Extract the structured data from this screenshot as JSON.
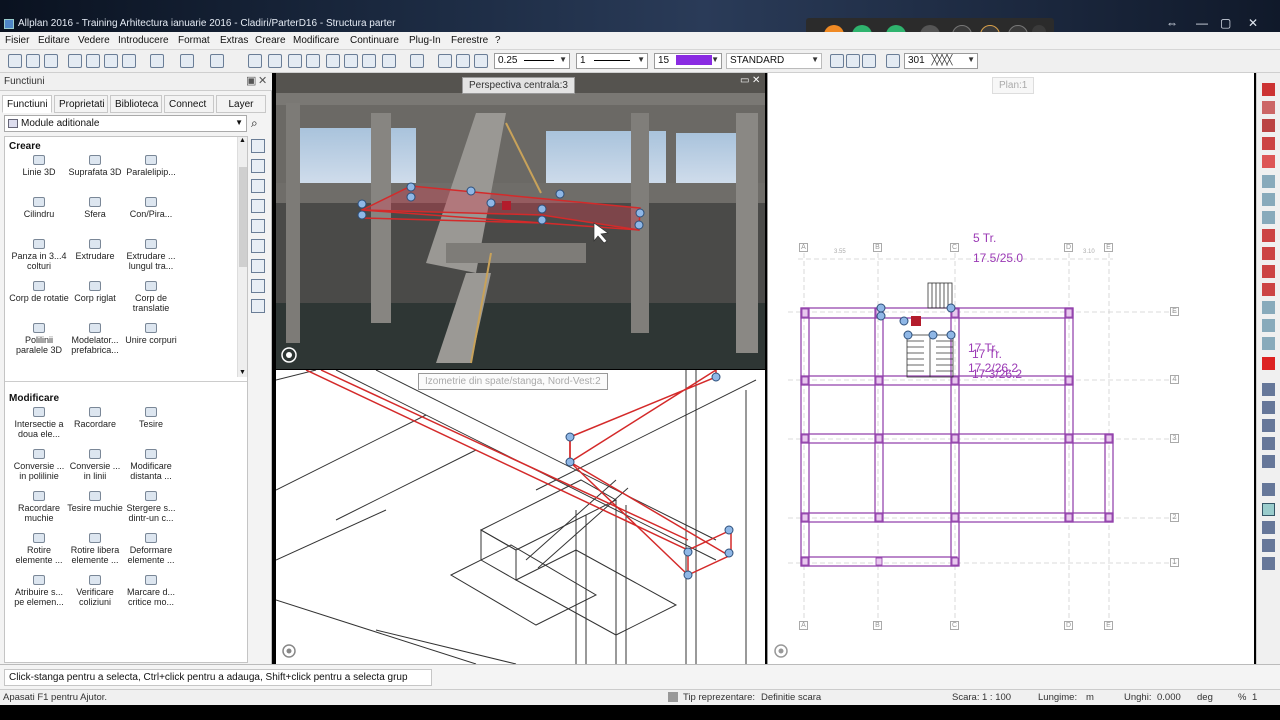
{
  "window": {
    "title": "Allplan 2016 - Training Arhitectura ianuarie 2016 - Cladiri/ParterD16 - Structura parter"
  },
  "menu": [
    "Fisier",
    "Editare",
    "Vedere",
    "Introducere",
    "Format",
    "Extras",
    "Creare",
    "Modificare",
    "Continuare",
    "Plug-In",
    "Ferestre",
    "?"
  ],
  "toolbar": {
    "pen_thickness": "0.25",
    "line_type": "1",
    "color_number": "15",
    "color_swatch": "#8a2be2",
    "layer": "STANDARD",
    "hatch_number": "301"
  },
  "panel": {
    "title": "Functiuni",
    "tabs": [
      "Functiuni",
      "Proprietati",
      "Biblioteca",
      "Connect",
      "Layer"
    ],
    "module": "Module aditionale",
    "section_create": "Creare",
    "create_tools": [
      {
        "icon": "line-3d-icon",
        "label": "Linie 3D"
      },
      {
        "icon": "surface-3d-icon",
        "label": "Suprafata 3D"
      },
      {
        "icon": "box-icon",
        "label": "Paralelipip..."
      },
      {
        "icon": "cylinder-icon",
        "label": "Cilindru"
      },
      {
        "icon": "sphere-icon",
        "label": "Sfera"
      },
      {
        "icon": "cone-icon",
        "label": "Con/Pira..."
      },
      {
        "icon": "panel-icon",
        "label": "Panza in 3...4 colturi"
      },
      {
        "icon": "extrusion-icon",
        "label": "Extrudare"
      },
      {
        "icon": "path-extrusion-icon",
        "label": "Extrudare ... lungul tra..."
      },
      {
        "icon": "rotation-body-icon",
        "label": "Corp de rotatie"
      },
      {
        "icon": "ruled-body-icon",
        "label": "Corp riglat"
      },
      {
        "icon": "translation-body-icon",
        "label": "Corp de translatie"
      },
      {
        "icon": "polyline-icon",
        "label": "Polilinii paralele 3D"
      },
      {
        "icon": "prefab-modeler-icon",
        "label": "Modelator... prefabrica..."
      },
      {
        "icon": "union-icon",
        "label": "Unire corpuri"
      }
    ],
    "section_modify": "Modificare",
    "modify_tools": [
      {
        "icon": "intersect-icon",
        "label": "Intersectie a doua ele..."
      },
      {
        "icon": "fillet-icon",
        "label": "Racordare"
      },
      {
        "icon": "chamfer-icon",
        "label": "Tesire"
      },
      {
        "icon": "convert-polyline-icon",
        "label": "Conversie ... in polilinie"
      },
      {
        "icon": "convert-lines-icon",
        "label": "Conversie ... in linii"
      },
      {
        "icon": "modify-distance-icon",
        "label": "Modificare distanta ..."
      },
      {
        "icon": "edge-fillet-icon",
        "label": "Racordare muchie"
      },
      {
        "icon": "edge-chamfer-icon",
        "label": "Tesire muchie"
      },
      {
        "icon": "delete-icon",
        "label": "Stergere s... dintr-un c..."
      },
      {
        "icon": "rotate-icon",
        "label": "Rotire elemente ..."
      },
      {
        "icon": "free-rotate-icon",
        "label": "Rotire libera elemente ..."
      },
      {
        "icon": "deform-icon",
        "label": "Deformare elemente ..."
      },
      {
        "icon": "assign-icon",
        "label": "Atribuire s... pe elemen..."
      },
      {
        "icon": "collision-icon",
        "label": "Verificare coliziuni"
      },
      {
        "icon": "critical-mark-icon",
        "label": "Marcare d... critice mo..."
      }
    ]
  },
  "views": {
    "perspective": "Perspectiva centrala:3",
    "isometric": "Izometrie din spate/stanga, Nord-Vest:2",
    "plan": "Plan:1"
  },
  "plan_labels": {
    "stair1_line1": "5 Tr.",
    "stair1_line2": "17.5/25.0",
    "stair2_line1a": "17 Tr.",
    "stair2_line1b": "17 Tr.",
    "stair2_line2a": "17.2/26.2",
    "stair2_line2b": "17.3/26.2",
    "dim1": "3.55",
    "dim2": "3.10",
    "grid_top": [
      "A",
      "B",
      "C",
      "D",
      "E"
    ],
    "grid_right": [
      "E",
      "4",
      "3",
      "2",
      "1"
    ]
  },
  "hint": "Click-stanga pentru a selecta, Ctrl+click pentru a adauga, Shift+click pentru a selecta grup",
  "status": {
    "help": "Apasati F1 pentru Ajutor.",
    "display_type_label": "Tip reprezentare:",
    "display_type_value": "Definitie scara",
    "scale_label": "Scara:",
    "scale_value": "1 : 100",
    "length_label": "Lungime:",
    "length_unit": "m",
    "angle_label": "Unghi:",
    "angle_value": "0.000",
    "angle_unit": "deg",
    "percent_label": "%",
    "percent_value": "1"
  }
}
